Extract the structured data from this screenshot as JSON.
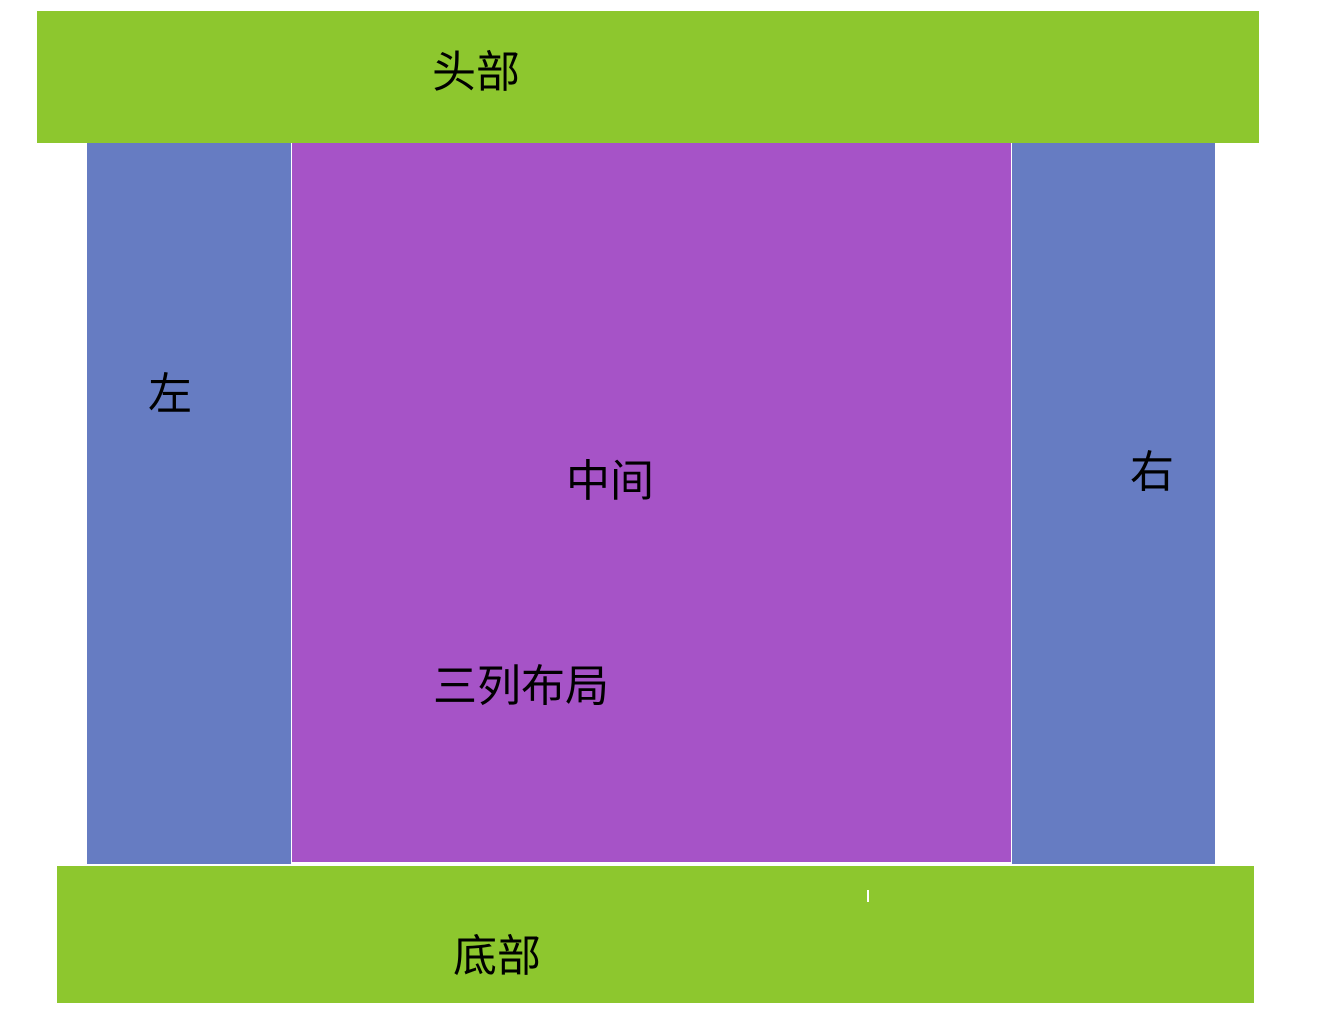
{
  "header": {
    "label": "头部"
  },
  "left": {
    "label": "左"
  },
  "middle": {
    "label": "中间",
    "caption": "三列布局"
  },
  "right": {
    "label": "右"
  },
  "footer": {
    "label": "底部"
  },
  "colors": {
    "header_footer": "#8dc72e",
    "side_columns": "#667cc2",
    "middle_column": "#a653c7",
    "background": "#ffffff"
  }
}
